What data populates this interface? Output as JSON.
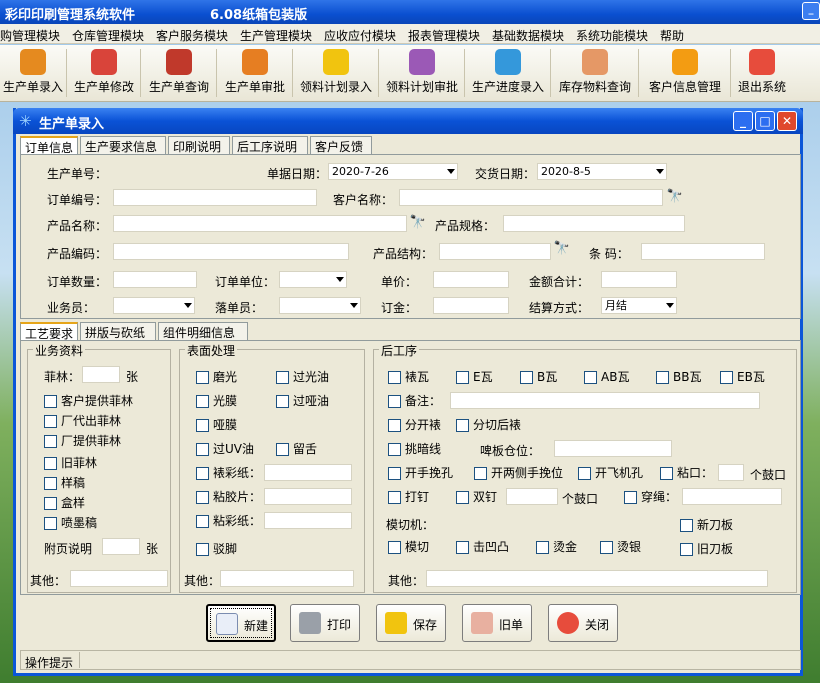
{
  "app_title": "彩印印刷管理系统软件",
  "app_version": "6.08纸箱包装版",
  "menus": [
    "购管理模块",
    "仓库管理模块",
    "客户服务模块",
    "生产管理模块",
    "应收应付模块",
    "报表管理模块",
    "基础数据模块",
    "系统功能模块",
    "帮助"
  ],
  "toolbar": [
    {
      "label": "生产单录入",
      "icon": "order-entry-icon",
      "color": "#e58a1f"
    },
    {
      "label": "生产单修改",
      "icon": "order-edit-icon",
      "color": "#d9443a"
    },
    {
      "label": "生产单查询",
      "icon": "order-query-icon",
      "color": "#c0392b"
    },
    {
      "label": "生产单审批",
      "icon": "order-approve-icon",
      "color": "#e67e22"
    },
    {
      "label": "领料计划录入",
      "icon": "material-plan-entry-icon",
      "color": "#f1c40f"
    },
    {
      "label": "领料计划审批",
      "icon": "material-plan-approve-icon",
      "color": "#9b59b6"
    },
    {
      "label": "生产进度录入",
      "icon": "progress-entry-icon",
      "color": "#3498db"
    },
    {
      "label": "库存物料查询",
      "icon": "inventory-query-icon",
      "color": "#e59866"
    },
    {
      "label": "客户信息管理",
      "icon": "customer-info-icon",
      "color": "#f39c12"
    },
    {
      "label": "退出系统",
      "icon": "exit-icon",
      "color": "#e74c3c"
    }
  ],
  "window_title": "生产单录入",
  "tabs_top": [
    "订单信息",
    "生产要求信息",
    "印刷说明",
    "后工序说明",
    "客户反馈"
  ],
  "order": {
    "order_no_label": "生产单号：",
    "doc_date_label": "单据日期：",
    "doc_date": "2020-7-26",
    "delivery_date_label": "交货日期：",
    "delivery_date": "2020-8-5",
    "order_code_label": "订单编号：",
    "customer_name_label": "客户名称：",
    "product_name_label": "产品名称：",
    "product_spec_label": "产品规格：",
    "product_code_label": "产品编码：",
    "product_structure_label": "产品结构：",
    "barcode_label": "条  码：",
    "quantity_label": "订单数量：",
    "unit_label": "订单单位：",
    "price_label": "单价：",
    "amount_label": "金额合计：",
    "salesman_label": "业务员：",
    "creator_label": "落单员：",
    "deposit_label": "订金：",
    "settle_label": "结算方式：",
    "settle_value": "月结"
  },
  "tabs_mid": [
    "工艺要求",
    "拼版与砍纸",
    "组件明细信息"
  ],
  "business": {
    "title": "业务资料",
    "film_label": "菲林：",
    "film_unit": "张",
    "checks": [
      "客户提供菲林",
      "厂代出菲林",
      "厂提供菲林",
      "旧菲林",
      "样稿",
      "盒样",
      "喷墨稿"
    ],
    "attach_label": "附页说明",
    "attach_unit": "张",
    "other_label": "其他："
  },
  "surface": {
    "title": "表面处理",
    "col1": [
      "磨光",
      "光膜",
      "哑膜",
      "过UV油"
    ],
    "col2": [
      "过光油",
      "过哑油",
      "",
      "留舌"
    ],
    "with_input": [
      "裱彩纸：",
      "粘胶片：",
      "粘彩纸："
    ],
    "last": "驳脚",
    "other_label": "其他："
  },
  "post": {
    "title": "后工序",
    "flutes": [
      "裱瓦",
      "E瓦",
      "B瓦",
      "AB瓦",
      "BB瓦",
      "EB瓦"
    ],
    "remark_label": "备注：",
    "row3": [
      "分开裱",
      "分切后裱"
    ],
    "darkline": "挑暗线",
    "beer_label": "啤板仓位：",
    "row5": [
      "开手挽孔",
      "开两侧手挽位",
      "开飞机孔",
      "粘口："
    ],
    "row5_unit": "个鼓口",
    "row6": [
      "打钉",
      "双钉"
    ],
    "row6_unit": "个鼓口",
    "rope": "穿绳：",
    "diecut_label": "模切机：",
    "row8": [
      "模切",
      "击凹凸",
      "烫金",
      "烫银"
    ],
    "knife": [
      "新刀板",
      "旧刀板"
    ],
    "other_label": "其他："
  },
  "buttons": [
    "新建",
    "打印",
    "保存",
    "旧单",
    "关闭"
  ],
  "status": "操作提示"
}
